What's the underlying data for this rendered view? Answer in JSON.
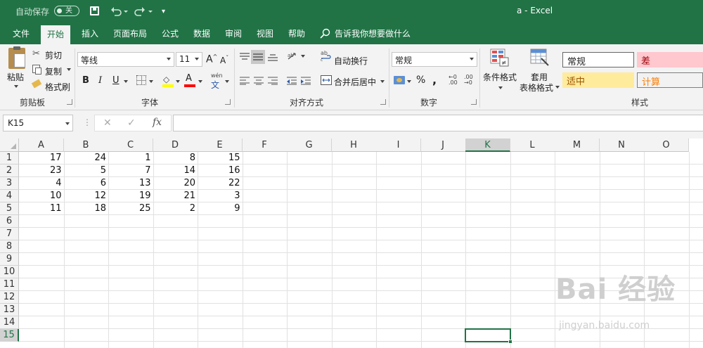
{
  "titlebar": {
    "autosave_label": "自动保存",
    "autosave_state": "关",
    "title": "a  -  Excel"
  },
  "tabs": [
    {
      "label": "文件"
    },
    {
      "label": "开始"
    },
    {
      "label": "插入"
    },
    {
      "label": "页面布局"
    },
    {
      "label": "公式"
    },
    {
      "label": "数据"
    },
    {
      "label": "审阅"
    },
    {
      "label": "视图"
    },
    {
      "label": "帮助"
    }
  ],
  "tell_me": "告诉我你想要做什么",
  "clipboard": {
    "paste": "粘贴",
    "cut": "剪切",
    "copy": "复制",
    "format_painter": "格式刷",
    "group": "剪贴板"
  },
  "font": {
    "name": "等线",
    "size": "11",
    "grow": "A",
    "shrink": "A",
    "bold": "B",
    "italic": "I",
    "underline": "U",
    "font_color": "A",
    "group": "字体",
    "wen": "wén",
    "wen_char": "文"
  },
  "alignment": {
    "wrap": "自动换行",
    "merge": "合并后居中",
    "group": "对齐方式"
  },
  "number": {
    "format": "常规",
    "percent": "%",
    "comma": ",",
    "group": "数字"
  },
  "styles": {
    "conditional_formatting": "条件格式",
    "format_as_table_line1": "套用",
    "format_as_table_line2": "表格格式",
    "normal": "常规",
    "bad": "差",
    "neutral": "适中",
    "calculation": "计算",
    "group": "样式"
  },
  "formula_bar": {
    "name_box": "K15",
    "value": ""
  },
  "columns": [
    "A",
    "B",
    "C",
    "D",
    "E",
    "F",
    "G",
    "H",
    "I",
    "J",
    "K",
    "L",
    "M",
    "N",
    "O"
  ],
  "selected_column": "K",
  "rows": [
    "1",
    "2",
    "3",
    "4",
    "5",
    "6",
    "7",
    "8",
    "9",
    "10",
    "11",
    "12",
    "13",
    "14",
    "15"
  ],
  "selected_row": "15",
  "cells": [
    [
      "17",
      "24",
      "1",
      "8",
      "15"
    ],
    [
      "23",
      "5",
      "7",
      "14",
      "16"
    ],
    [
      "4",
      "6",
      "13",
      "20",
      "22"
    ],
    [
      "10",
      "12",
      "19",
      "21",
      "3"
    ],
    [
      "11",
      "18",
      "25",
      "2",
      "9"
    ]
  ],
  "watermark": {
    "line1": "Bai 经验",
    "line2": "jingyan.baidu.com"
  },
  "colors": {
    "excel_green": "#217346",
    "bad_fill": "#ffc7ce",
    "bad_text": "#9c0006",
    "neutral_fill": "#ffeb9c",
    "neutral_text": "#9c5700",
    "calc_fill": "#f2f2f2",
    "calc_text": "#fa7d00"
  }
}
